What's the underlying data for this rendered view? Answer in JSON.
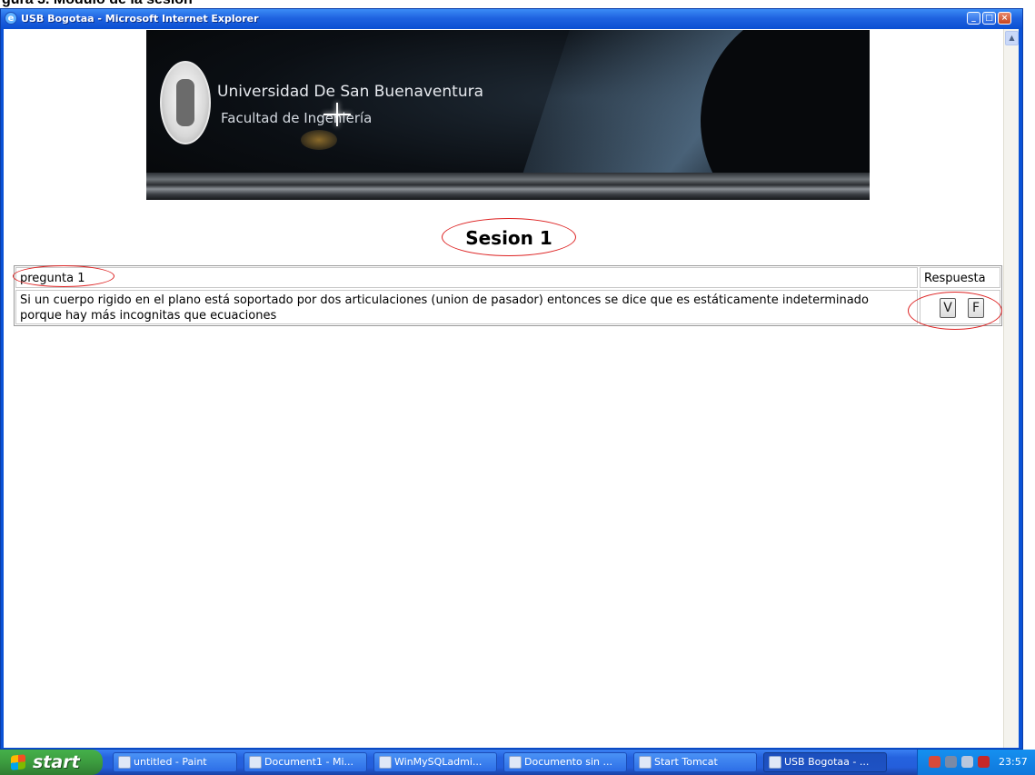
{
  "document_caption": "gura 3. Modulo de la sesión",
  "window": {
    "title": "USB Bogotaa - Microsoft Internet Explorer"
  },
  "banner": {
    "university": "Universidad De San Buenaventura",
    "faculty": "Facultad de Ingeniería"
  },
  "session": {
    "title": "Sesion 1"
  },
  "question_table": {
    "question_label": "pregunta 1",
    "answer_header": "Respuesta",
    "question_text": "Si un cuerpo rigido en el plano está soportado por dos articulaciones (union de pasador) entonces se dice que es estáticamente indeterminado porque hay más incognitas que ecuaciones",
    "true_button": "V",
    "false_button": "F"
  },
  "taskbar": {
    "start_label": "start",
    "tasks": [
      {
        "label": "untitled - Paint",
        "icon": "paint-icon"
      },
      {
        "label": "Document1 - Mi...",
        "icon": "word-icon"
      },
      {
        "label": "WinMySQLadmi...",
        "icon": "sql-icon"
      },
      {
        "label": "Documento sin ...",
        "icon": "ie-icon"
      },
      {
        "label": "Start Tomcat",
        "icon": "tomcat-icon"
      },
      {
        "label": "USB Bogotaa - ...",
        "icon": "ie-icon"
      }
    ],
    "clock": "23:57"
  },
  "colors": {
    "annotation_red": "#dd2222",
    "titlebar_blue": "#0a52d6",
    "taskbar_blue": "#245edb",
    "start_green": "#3c9c3f"
  }
}
